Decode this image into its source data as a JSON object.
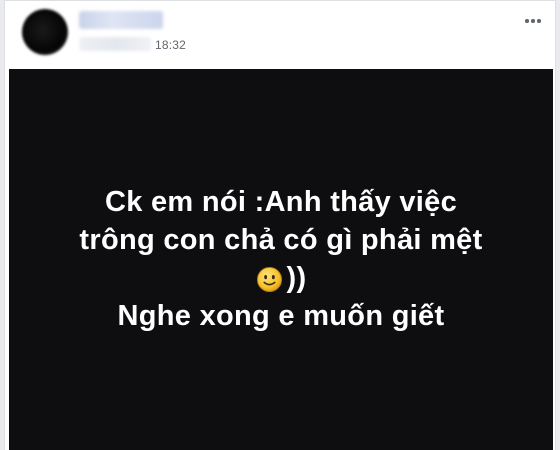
{
  "post": {
    "author_name": "",
    "time": "18:32",
    "more_icon": "more-horizontal-icon",
    "avatar_icon": "blurred-avatar",
    "status": {
      "line1": "Ck em nói :Anh thấy việc",
      "line2": "trông con chả có gì phải mệt",
      "line3_emoji": "slightly-smiling-face-emoji",
      "line3_text": "))",
      "line4": "Nghe xong e muốn giết"
    },
    "colors": {
      "background": "#0e0e10",
      "text": "#ffffff",
      "emoji": "#f5c02a"
    }
  }
}
